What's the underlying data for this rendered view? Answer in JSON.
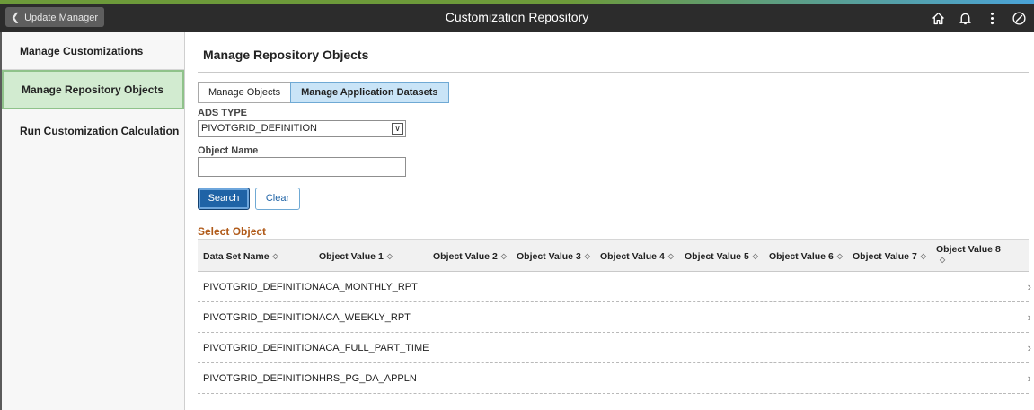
{
  "header": {
    "back_label": "Update Manager",
    "title": "Customization Repository",
    "icons": [
      "home-icon",
      "bell-icon",
      "more-vertical-icon",
      "navbar-compass-icon"
    ],
    "accent_colors": [
      "#6d9a3a",
      "#4aa3d8"
    ]
  },
  "sidebar": {
    "items": [
      {
        "label": "Manage Customizations",
        "active": false
      },
      {
        "label": "Manage Repository Objects",
        "active": true
      },
      {
        "label": "Run Customization Calculation",
        "active": false
      }
    ]
  },
  "main": {
    "page_title": "Manage Repository Objects",
    "tabs": [
      {
        "label": "Manage Objects",
        "selected": false
      },
      {
        "label": "Manage Application Datasets",
        "selected": true
      }
    ],
    "ads_type_label": "ADS TYPE",
    "ads_type_value": "PIVOTGRID_DEFINITION",
    "object_name_label": "Object Name",
    "object_name_value": "",
    "search_label": "Search",
    "clear_label": "Clear",
    "section_title": "Select Object",
    "columns": [
      "Data Set Name",
      "Object Value 1",
      "Object Value 2",
      "Object Value 3",
      "Object Value 4",
      "Object Value 5",
      "Object Value 6",
      "Object Value 7",
      "Object Value 8"
    ],
    "rows": [
      {
        "dataset": "PIVOTGRID_DEFINITION",
        "value1": "ACA_MONTHLY_RPT"
      },
      {
        "dataset": "PIVOTGRID_DEFINITION",
        "value1": "ACA_WEEKLY_RPT"
      },
      {
        "dataset": "PIVOTGRID_DEFINITION",
        "value1": "ACA_FULL_PART_TIME"
      },
      {
        "dataset": "PIVOTGRID_DEFINITION",
        "value1": "HRS_PG_DA_APPLN"
      }
    ]
  },
  "colors": {
    "topbar": "#2c2c2c",
    "active_nav": "#d2ebd0",
    "primary_button": "#1f63a6",
    "section_title": "#b05a19",
    "selected_tab": "#c9e4f7"
  }
}
